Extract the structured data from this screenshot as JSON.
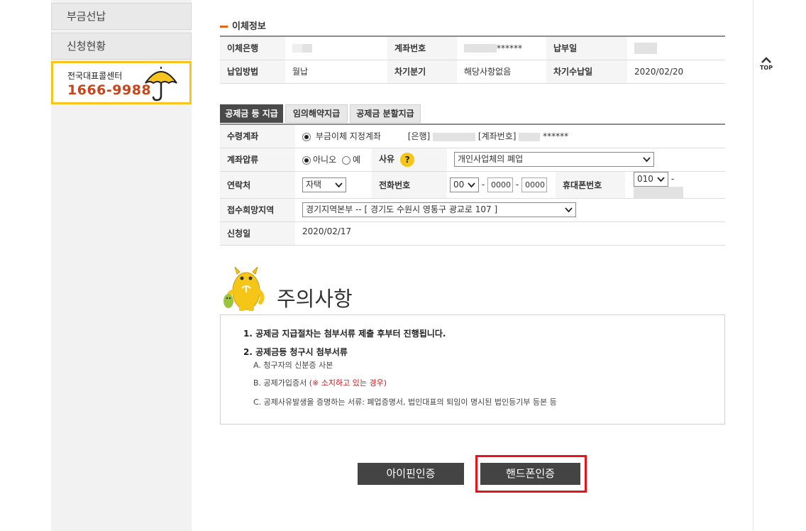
{
  "sidebar": {
    "items": [
      {
        "label": "부금선납"
      },
      {
        "label": "신청현황"
      }
    ],
    "callcenter": {
      "label": "전국대표콜센터",
      "number": "1666-9988",
      "icon": "umbrella-icon"
    }
  },
  "top_button": {
    "label": "TOP",
    "icon": "chevron-up-icon"
  },
  "transfer_info": {
    "title": "이체정보",
    "row1": {
      "bank_label": "이체은행",
      "bank_value": "",
      "account_label": "계좌번호",
      "account_value": "******",
      "due_label": "납부일",
      "due_value": ""
    },
    "row2": {
      "method_label": "납입방법",
      "method_value": "월납",
      "next_quarter_label": "차기분기",
      "next_quarter_value": "해당사항없음",
      "next_date_label": "차기수납일",
      "next_date_value": "2020/02/20"
    }
  },
  "tabs": [
    {
      "label": "공제금 등 지급",
      "active": true
    },
    {
      "label": "임의해약지급",
      "active": false
    },
    {
      "label": "공제금 분할지급",
      "active": false
    }
  ],
  "form": {
    "account": {
      "label": "수령계좌",
      "option": "부금이체 지정계좌",
      "bank_tag": "[은행]",
      "account_tag": "[계좌번호]",
      "account_mask": "******"
    },
    "seizure": {
      "label": "계좌압류",
      "no": "아니오",
      "yes": "예",
      "reason_label": "사유",
      "help": "?",
      "reason_value": "개인사업체의 폐업"
    },
    "contact": {
      "label": "연락처",
      "type_value": "자택",
      "phone_label": "전화번호",
      "phone_area": "00",
      "phone_mid": "0000",
      "phone_last": "0000",
      "dash": "-",
      "mobile_label": "휴대폰번호",
      "mobile_prefix": "010"
    },
    "region": {
      "label": "접수희망지역",
      "value": "경기지역본부 -- [ 경기도 수원시 영통구 광교로 107 ]"
    },
    "date": {
      "label": "신청일",
      "value": "2020/02/17"
    }
  },
  "caution": {
    "title": "주의사항",
    "item1": "1. 공제금 지급절차는 첨부서류 제출 후부터 진행됩니다.",
    "item2": "2. 공제금등 청구시 첨부서류",
    "sub_a": "A. 청구자의 신분증 사본",
    "sub_b": "B. 공제가입증서",
    "sub_b_note": "(※ 소지하고 있는 경우)",
    "sub_c": "C. 공제사유발생을 증명하는 서류: 폐업증명서, 법인대표의 퇴임이 명시된 법인등기부 등본 등"
  },
  "buttons": {
    "ipin": "아이핀인증",
    "phone": "핸드폰인증"
  },
  "colors": {
    "accent": "#e8661c",
    "highlight": "#e3151a",
    "callcenter_border": "#f7c51e",
    "dark_button": "#444444"
  }
}
